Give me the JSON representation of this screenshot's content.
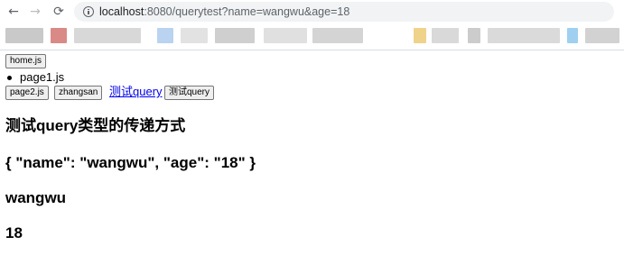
{
  "browser": {
    "url_host": "localhost",
    "url_path": ":8080/querytest?name=wangwu&age=18"
  },
  "page": {
    "buttons": {
      "home": "home.js",
      "page2": "page2.js",
      "zhangsan": "zhangsan",
      "query_button": "测试query"
    },
    "list_item": "page1.js",
    "query_link": "测试query",
    "headings": {
      "title": "测试query类型的传递方式",
      "query_json": "{ \"name\": \"wangwu\", \"age\": \"18\" }",
      "name": "wangwu",
      "age": "18"
    }
  }
}
